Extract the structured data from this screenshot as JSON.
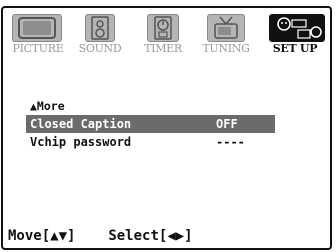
{
  "tabs": [
    {
      "label": "PICTURE",
      "icon": "tv-icon",
      "active": false
    },
    {
      "label": "SOUND",
      "icon": "speaker-icon",
      "active": false
    },
    {
      "label": "TIMER",
      "icon": "timer-icon",
      "active": false
    },
    {
      "label": "TUNING",
      "icon": "antenna-tv-icon",
      "active": false
    },
    {
      "label": "SET UP",
      "icon": "setup-icon",
      "active": true
    }
  ],
  "menu": {
    "more_label": "▲More",
    "items": [
      {
        "label": "Closed Caption",
        "value": "OFF",
        "selected": true
      },
      {
        "label": "Vchip password",
        "value": "----",
        "selected": false
      }
    ]
  },
  "footer": {
    "move": "Move[▲▼]",
    "select": "Select[◀▶]"
  },
  "colors": {
    "inactive_tab": "#b5b5b5",
    "active_tab": "#111111",
    "selected_row": "#6b6b6b"
  }
}
